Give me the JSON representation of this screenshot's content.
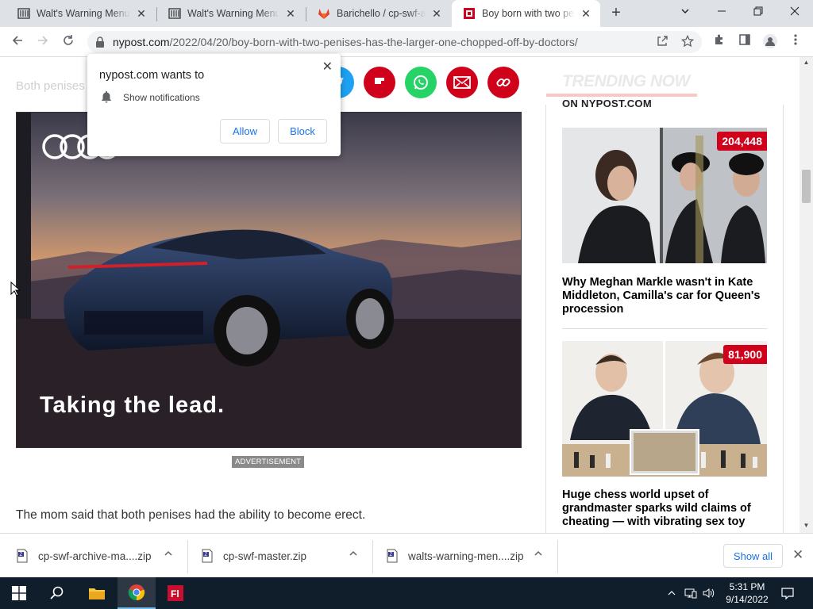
{
  "browser": {
    "tabs": [
      {
        "title": "Walt's Warning Menu Script",
        "icon": "archive-icon"
      },
      {
        "title": "Walt's Warning Menu Script",
        "icon": "archive-icon"
      },
      {
        "title": "Barichello / cp-swf-archive",
        "icon": "gitlab-icon"
      },
      {
        "title": "Boy born with two penises",
        "icon": "nypost-icon"
      }
    ],
    "close_glyph": "✕",
    "new_tab_glyph": "+",
    "url_domain": "nypost.com",
    "url_path": "/2022/04/20/boy-born-with-two-penises-has-the-larger-one-chopped-off-by-doctors/"
  },
  "notification": {
    "title": "nypost.com wants to",
    "permission": "Show notifications",
    "allow_label": "Allow",
    "block_label": "Block",
    "close_glyph": "✕"
  },
  "page": {
    "faded_text": "Both penises",
    "ad": {
      "headline": "Taking the lead.",
      "tag": "ADVERTISEMENT"
    },
    "article_text": "The mom said that both penises had the ability to become erect.",
    "sidebar": {
      "heading": "TRENDING NOW",
      "subheading": "ON NYPOST.COM",
      "stories": [
        {
          "count": "204,448",
          "title": "Why Meghan Markle wasn't in Kate Middleton, Camilla's car for Queen's procession"
        },
        {
          "count": "81,900",
          "title": "Huge chess world upset of grandmaster sparks wild claims of cheating — with vibrating sex toy"
        }
      ]
    }
  },
  "downloads": {
    "items": [
      {
        "name": "cp-swf-archive-ma....zip"
      },
      {
        "name": "cp-swf-master.zip"
      },
      {
        "name": "walts-warning-men....zip"
      }
    ],
    "show_all_label": "Show all",
    "close_glyph": "✕"
  },
  "taskbar": {
    "time": "5:31 PM",
    "date": "9/14/2022"
  },
  "colors": {
    "nypost_red": "#d0021b",
    "tab_strip": "#dee1e6",
    "link_blue": "#1a73e8",
    "taskbar": "#101d2b"
  }
}
